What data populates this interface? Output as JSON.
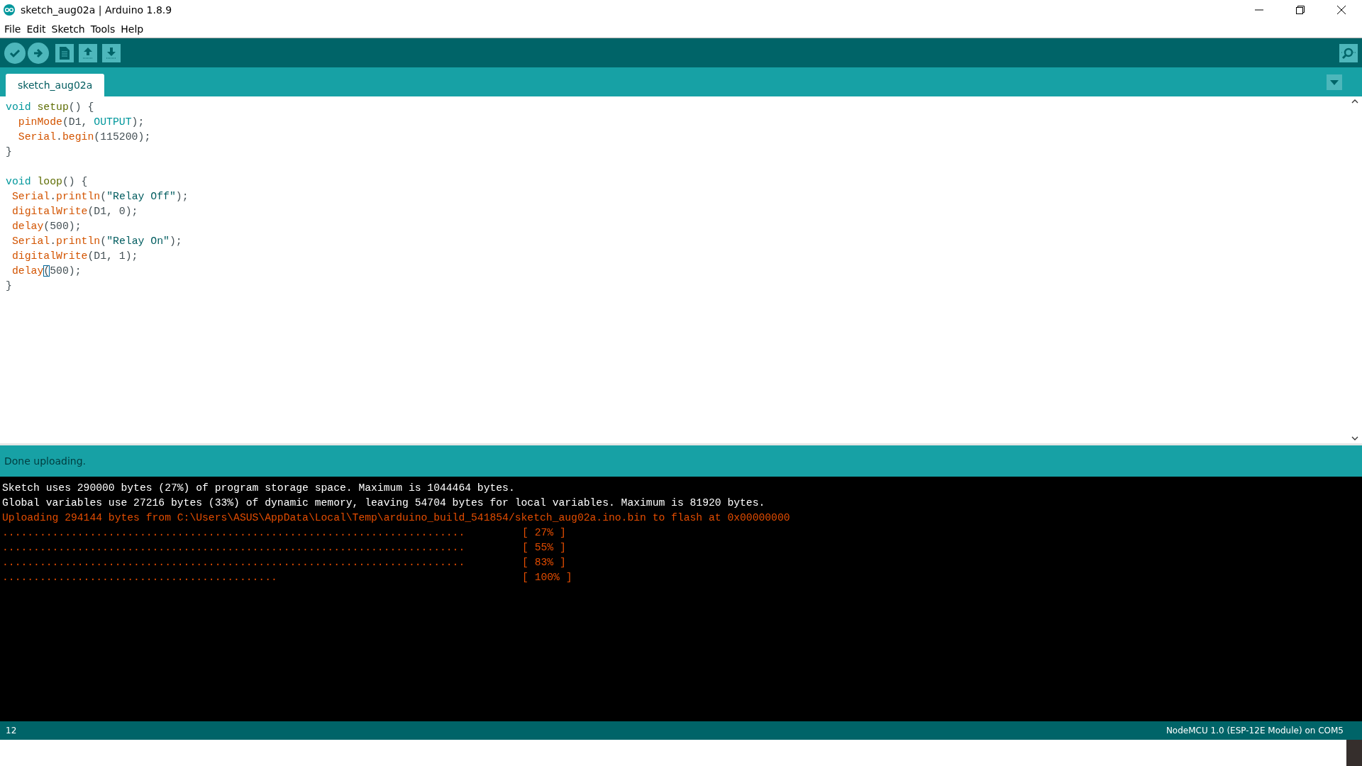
{
  "window": {
    "title": "sketch_aug02a | Arduino 1.8.9"
  },
  "menu": [
    "File",
    "Edit",
    "Sketch",
    "Tools",
    "Help"
  ],
  "tabs": [
    {
      "label": "sketch_aug02a",
      "selected": true
    }
  ],
  "editor": {
    "blocks": [
      [
        [
          {
            "kind": "type",
            "text": "void "
          },
          {
            "kind": "structure",
            "text": "setup"
          },
          {
            "kind": "plain",
            "text": "() {"
          }
        ],
        [
          {
            "kind": "function",
            "text": "  pinMode"
          },
          {
            "kind": "plain",
            "text": "(D1, "
          },
          {
            "kind": "constant",
            "text": "OUTPUT"
          },
          {
            "kind": "plain",
            "text": ");"
          }
        ],
        [
          {
            "kind": "function",
            "text": "  Serial"
          },
          {
            "kind": "plain",
            "text": "."
          },
          {
            "kind": "function",
            "text": "begin"
          },
          {
            "kind": "plain",
            "text": "(115200);"
          }
        ],
        [
          {
            "kind": "plain",
            "text": "}"
          }
        ]
      ],
      [
        [
          {
            "kind": "type",
            "text": "void "
          },
          {
            "kind": "structure",
            "text": "loop"
          },
          {
            "kind": "plain",
            "text": "() {"
          }
        ],
        [
          {
            "kind": "function",
            "text": " Serial"
          },
          {
            "kind": "plain",
            "text": "."
          },
          {
            "kind": "function",
            "text": "println"
          },
          {
            "kind": "plain",
            "text": "("
          },
          {
            "kind": "string",
            "text": "\"Relay Off\""
          },
          {
            "kind": "plain",
            "text": ");"
          }
        ],
        [
          {
            "kind": "function",
            "text": " digitalWrite"
          },
          {
            "kind": "plain",
            "text": "(D1, 0);"
          }
        ],
        [
          {
            "kind": "function",
            "text": " delay"
          },
          {
            "kind": "plain",
            "text": "(500);"
          }
        ],
        [
          {
            "kind": "function",
            "text": " Serial"
          },
          {
            "kind": "plain",
            "text": "."
          },
          {
            "kind": "function",
            "text": "println"
          },
          {
            "kind": "plain",
            "text": "("
          },
          {
            "kind": "string",
            "text": "\"Relay On\""
          },
          {
            "kind": "plain",
            "text": ");"
          }
        ],
        [
          {
            "kind": "function",
            "text": " digitalWrite"
          },
          {
            "kind": "plain",
            "text": "(D1, 1);"
          }
        ],
        [
          {
            "kind": "function",
            "text": " delay"
          },
          {
            "kind": "bracket",
            "text": "("
          },
          {
            "kind": "plain",
            "text": "500);"
          }
        ],
        [
          {
            "kind": "plain",
            "text": "}"
          }
        ]
      ]
    ]
  },
  "message": "Done uploading.",
  "console": [
    {
      "kind": "info",
      "text": "Sketch uses 290000 bytes (27%) of program storage space. Maximum is 1044464 bytes."
    },
    {
      "kind": "info",
      "text": "Global variables use 27216 bytes (33%) of dynamic memory, leaving 54704 bytes for local variables. Maximum is 81920 bytes."
    },
    {
      "kind": "upload",
      "text": "Uploading 294144 bytes from C:\\Users\\ASUS\\AppData\\Local\\Temp\\arduino_build_541854/sketch_aug02a.ino.bin to flash at 0x00000000"
    },
    {
      "kind": "progress",
      "text": "..........................................................................",
      "percent": "[ 27% ]"
    },
    {
      "kind": "progress",
      "text": "..........................................................................",
      "percent": "[ 55% ]"
    },
    {
      "kind": "progress",
      "text": "..........................................................................",
      "percent": "[ 83% ]"
    },
    {
      "kind": "progress",
      "text": "............................................",
      "percent": "[ 100% ]"
    }
  ],
  "status_bar": {
    "line": "12",
    "board": "NodeMCU 1.0 (ESP-12E Module) on COM5"
  }
}
